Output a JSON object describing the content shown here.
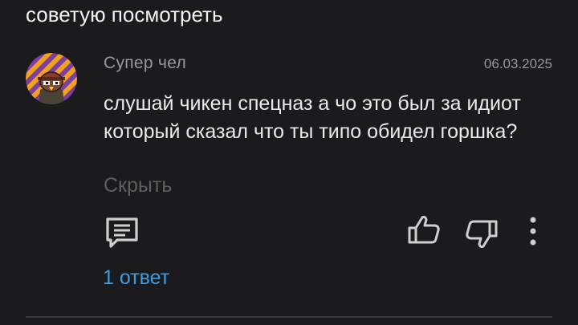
{
  "previous_comment": {
    "text_tail": "советую посмотреть"
  },
  "comment": {
    "author": "Супер чел",
    "date": "06.03.2025",
    "text": "слушай чикен спецназ а чо это был за идиот который сказал что ты типо обидел горшка?",
    "hide_label": "Скрыть",
    "replies_label": "1 ответ",
    "avatar": {
      "icon": "cartoon-avatar",
      "colors": [
        "#f2a31b",
        "#7b3fa0"
      ]
    }
  },
  "actions": {
    "reply_icon": "comment-reply-icon",
    "like_icon": "thumbs-up-icon",
    "dislike_icon": "thumbs-down-icon",
    "more_icon": "more-vertical-icon"
  },
  "colors": {
    "background": "#1b1b1d",
    "text_primary": "#eaeaea",
    "text_secondary": "#9a9a9a",
    "link": "#3d9ee6"
  }
}
